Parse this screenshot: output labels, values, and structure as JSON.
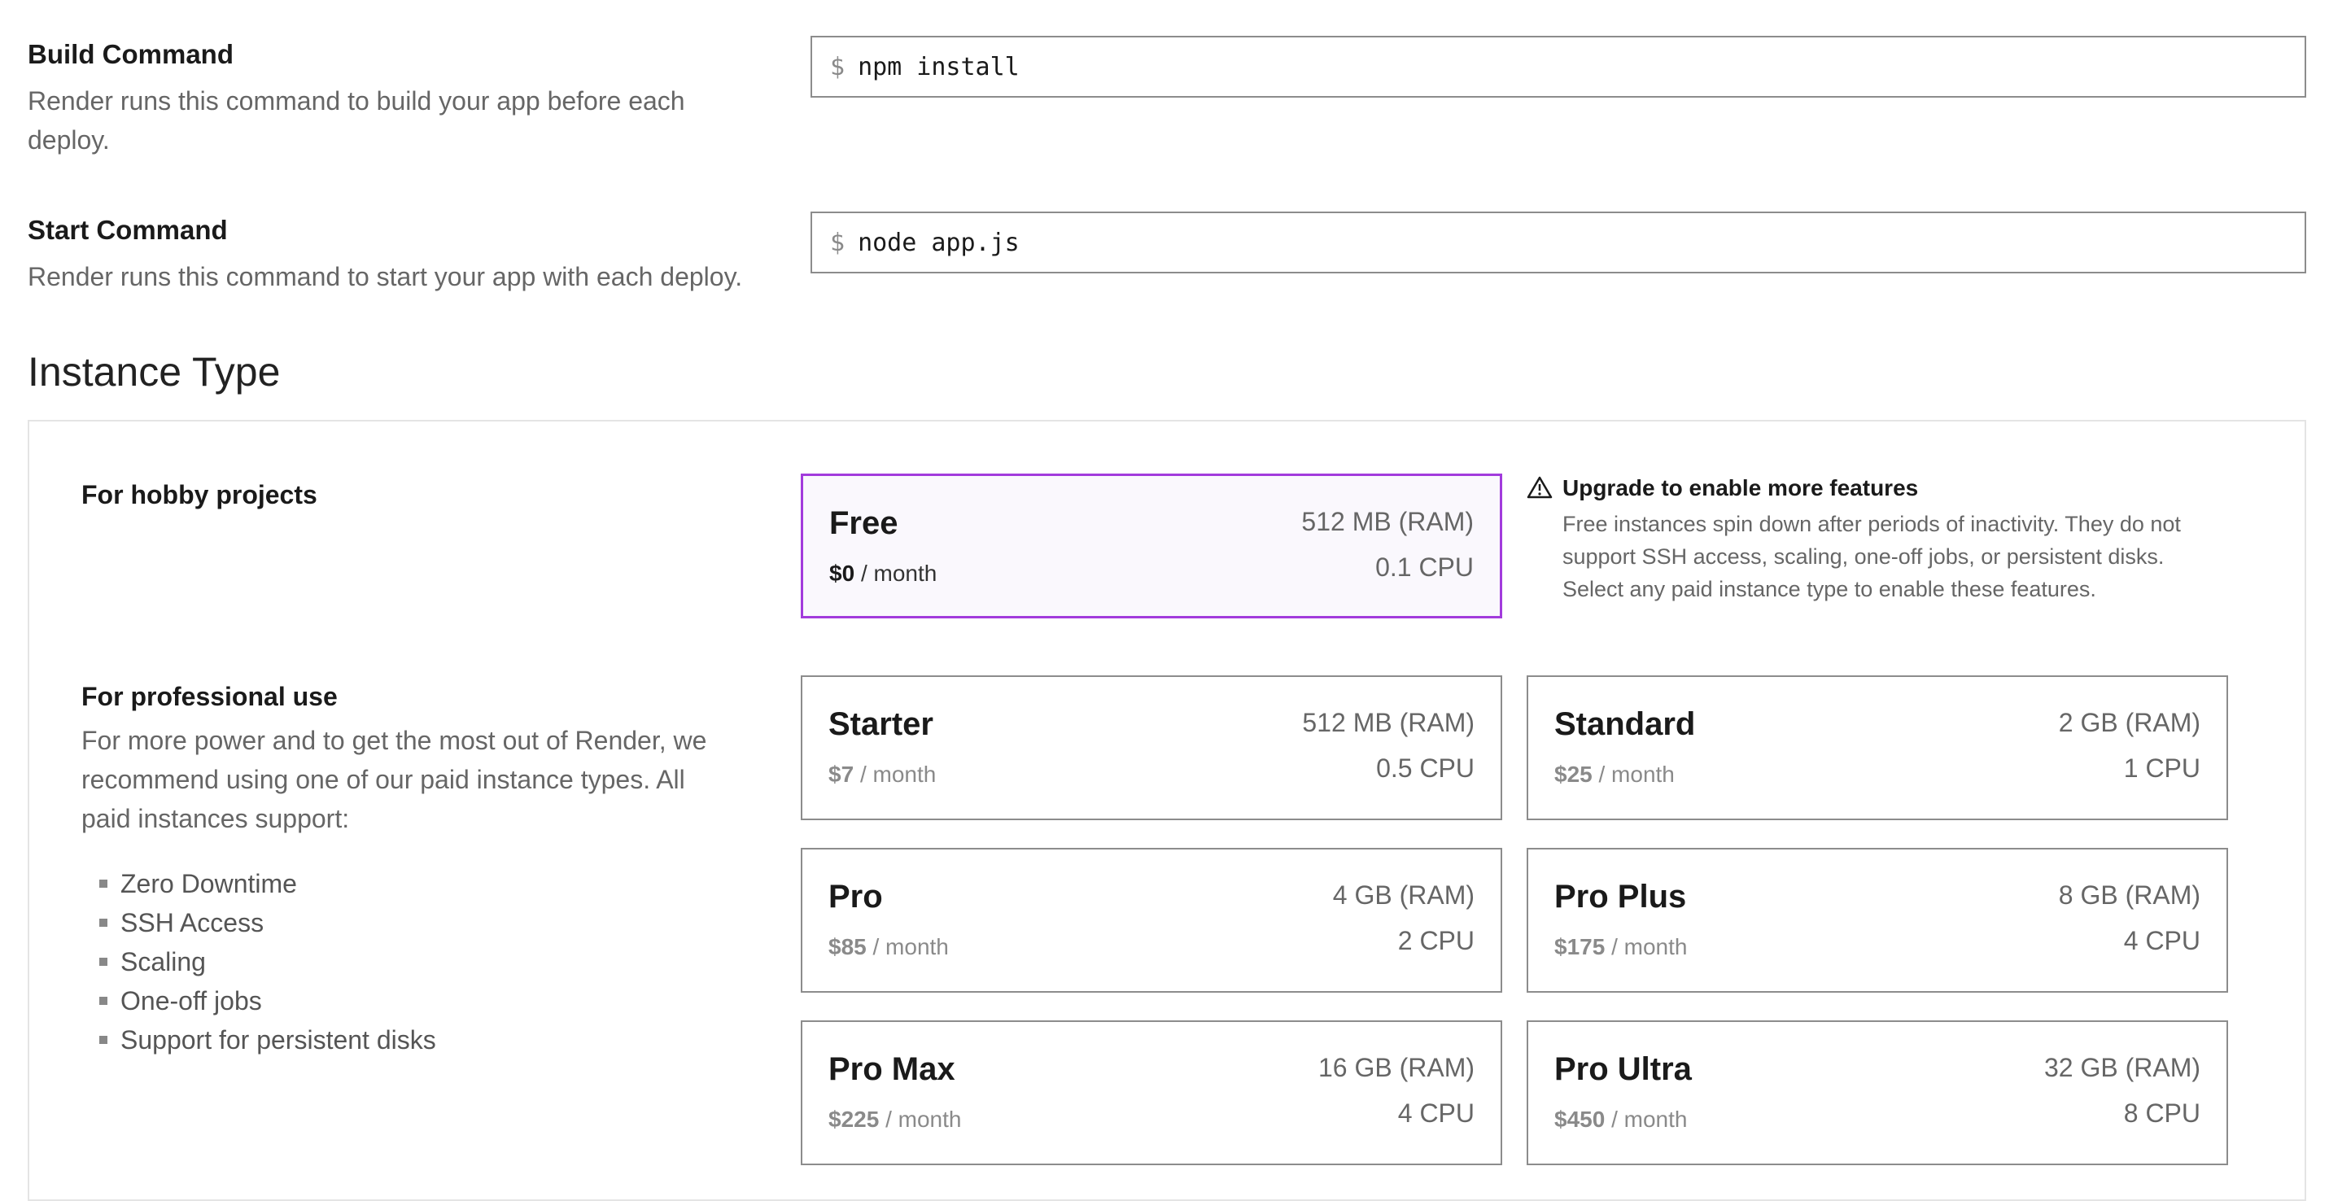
{
  "build": {
    "title": "Build Command",
    "description": "Render runs this command to build your app before each deploy.",
    "prompt": "$",
    "value": "npm install"
  },
  "start": {
    "title": "Start Command",
    "description": "Render runs this command to start your app with each deploy.",
    "prompt": "$",
    "value": "node app.js"
  },
  "instance": {
    "title": "Instance Type",
    "hobby_title": "For hobby projects",
    "pro_title": "For professional use",
    "pro_description": "For more power and to get the most out of Render, we recommend using one of our paid instance types. All paid instances support:",
    "features": [
      "Zero Downtime",
      "SSH Access",
      "Scaling",
      "One-off jobs",
      "Support for persistent disks"
    ],
    "per_month": "/ month",
    "warning_icon": "warning-triangle-icon",
    "notice": {
      "title": "Upgrade to enable more features",
      "body": "Free instances spin down after periods of inactivity. They do not support SSH access, scaling, one-off jobs, or persistent disks. Select any paid instance type to enable these features."
    },
    "plans": [
      {
        "name": "Free",
        "price": "$0",
        "ram": "512 MB (RAM)",
        "cpu": "0.1 CPU"
      },
      {
        "name": "Starter",
        "price": "$7",
        "ram": "512 MB (RAM)",
        "cpu": "0.5 CPU"
      },
      {
        "name": "Standard",
        "price": "$25",
        "ram": "2 GB (RAM)",
        "cpu": "1 CPU"
      },
      {
        "name": "Pro",
        "price": "$85",
        "ram": "4 GB (RAM)",
        "cpu": "2 CPU"
      },
      {
        "name": "Pro Plus",
        "price": "$175",
        "ram": "8 GB (RAM)",
        "cpu": "4 CPU"
      },
      {
        "name": "Pro Max",
        "price": "$225",
        "ram": "16 GB (RAM)",
        "cpu": "4 CPU"
      },
      {
        "name": "Pro Ultra",
        "price": "$450",
        "ram": "32 GB (RAM)",
        "cpu": "8 CPU"
      }
    ]
  },
  "colors": {
    "selected_border": "#a23bdc",
    "selected_bg": "#faf8fd",
    "border": "#8c8c8c"
  }
}
